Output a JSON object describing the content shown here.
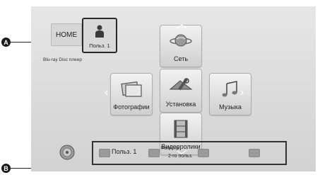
{
  "home": {
    "label": "HOME"
  },
  "user": {
    "label": "Польз. 1"
  },
  "device_name": "Blu-ray Disc плеер",
  "menu": {
    "network": "Сеть",
    "photos": "Фотографии",
    "setup": "Установка",
    "music": "Музыка",
    "videos": "Видеоролики"
  },
  "bottom_bar": {
    "user_label": "Польз. 1",
    "register_line1": "Регистр.",
    "register_line2": "2-го польз."
  },
  "callouts": {
    "a": "A",
    "b": "B"
  },
  "colors": {
    "background": "#d8d8d8",
    "button": "#9a9a9a",
    "frame": "#333333"
  },
  "icons": [
    "person-icon",
    "globe-icon",
    "photos-icon",
    "setup-icon",
    "music-icon",
    "film-icon",
    "disc-icon"
  ]
}
